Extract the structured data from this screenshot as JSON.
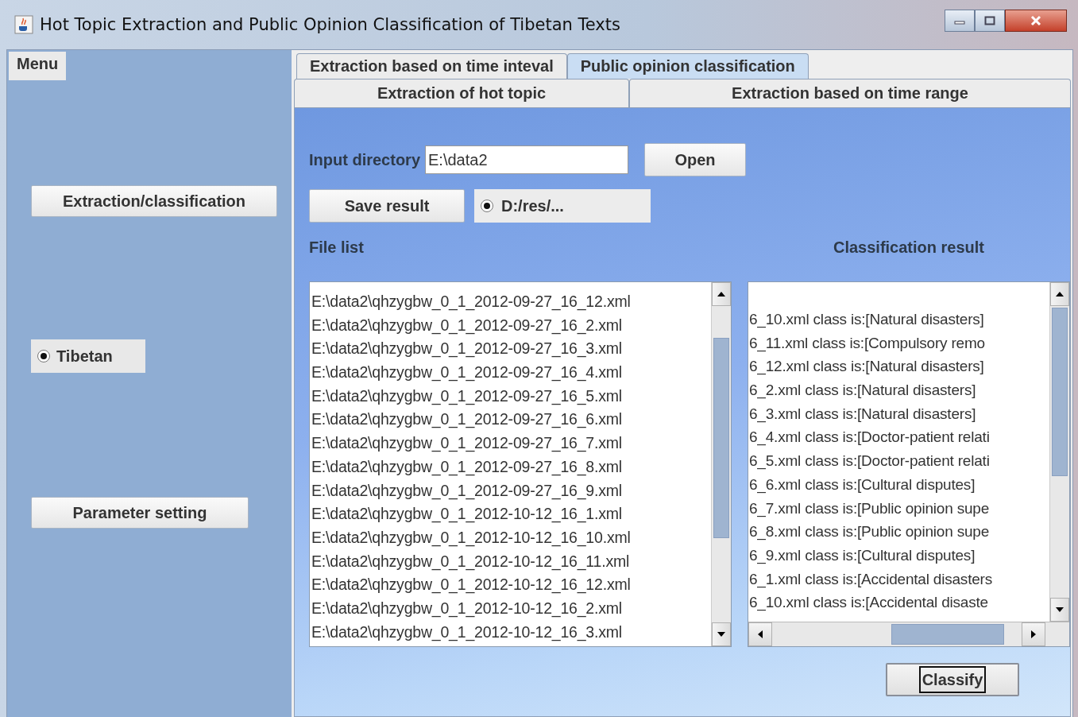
{
  "window": {
    "title": "Hot Topic Extraction and Public Opinion Classification of Tibetan Texts"
  },
  "sidebar": {
    "menu_label": "Menu",
    "buttons": [
      {
        "kind": "button",
        "label": "Extraction/classification"
      },
      {
        "kind": "radio",
        "label": "Tibetan",
        "selected": true
      },
      {
        "kind": "button",
        "label": "Parameter setting"
      }
    ]
  },
  "tabs_row_1": [
    {
      "label": "Extraction based on time inteval",
      "selected": false
    },
    {
      "label": "Public opinion classification",
      "selected": true
    }
  ],
  "tabs_row_2": [
    {
      "label": "Extraction of hot  topic",
      "selected": false
    },
    {
      "label": "Extraction based on time range",
      "selected": false
    }
  ],
  "input_directory": {
    "label": "Input directory",
    "value": "E:\\data2",
    "button": "Open"
  },
  "save": {
    "button": "Save result",
    "option": {
      "label": "D:/res/...",
      "selected": true
    }
  },
  "file_list": {
    "label": "File list",
    "items": [
      "E:\\data2\\qhzygbw_0_1_2012-09-27_16_12.xml",
      "E:\\data2\\qhzygbw_0_1_2012-09-27_16_2.xml",
      "E:\\data2\\qhzygbw_0_1_2012-09-27_16_3.xml",
      "E:\\data2\\qhzygbw_0_1_2012-09-27_16_4.xml",
      "E:\\data2\\qhzygbw_0_1_2012-09-27_16_5.xml",
      "E:\\data2\\qhzygbw_0_1_2012-09-27_16_6.xml",
      "E:\\data2\\qhzygbw_0_1_2012-09-27_16_7.xml",
      "E:\\data2\\qhzygbw_0_1_2012-09-27_16_8.xml",
      "E:\\data2\\qhzygbw_0_1_2012-09-27_16_9.xml",
      "E:\\data2\\qhzygbw_0_1_2012-10-12_16_1.xml",
      "E:\\data2\\qhzygbw_0_1_2012-10-12_16_10.xml",
      "E:\\data2\\qhzygbw_0_1_2012-10-12_16_11.xml",
      "E:\\data2\\qhzygbw_0_1_2012-10-12_16_12.xml",
      "E:\\data2\\qhzygbw_0_1_2012-10-12_16_2.xml",
      "E:\\data2\\qhzygbw_0_1_2012-10-12_16_3.xml"
    ]
  },
  "classification_result": {
    "label": "Classification result",
    "items": [
      "6_10.xml class is:[Natural disasters]",
      "6_11.xml class is:[Compulsory remo",
      "6_12.xml class is:[Natural disasters]",
      "6_2.xml class is:[Natural disasters]",
      "6_3.xml class is:[Natural disasters]",
      "6_4.xml class is:[Doctor-patient relati",
      "6_5.xml class is:[Doctor-patient relati",
      "6_6.xml class is:[Cultural disputes]",
      "6_7.xml class is:[Public opinion supe",
      "6_8.xml class is:[Public opinion supe",
      "6_9.xml class is:[Cultural disputes]",
      "6_1.xml class is:[Accidental disasters",
      "6_10.xml class is:[Accidental disaste"
    ]
  },
  "classify_button": "Classify"
}
